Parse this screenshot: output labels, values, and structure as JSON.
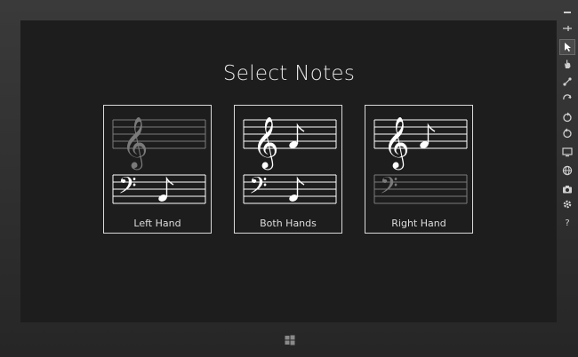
{
  "page": {
    "title": "Select Notes"
  },
  "cards": [
    {
      "label": "Left Hand"
    },
    {
      "label": "Both Hands"
    },
    {
      "label": "Right Hand"
    }
  ],
  "toolbar": {
    "help_label": "?"
  },
  "colors": {
    "screen": "#1d1d1d",
    "bezel": "#2b2b2b",
    "active_staff": "#ffffff",
    "inactive_staff": "#7a7a7a"
  }
}
